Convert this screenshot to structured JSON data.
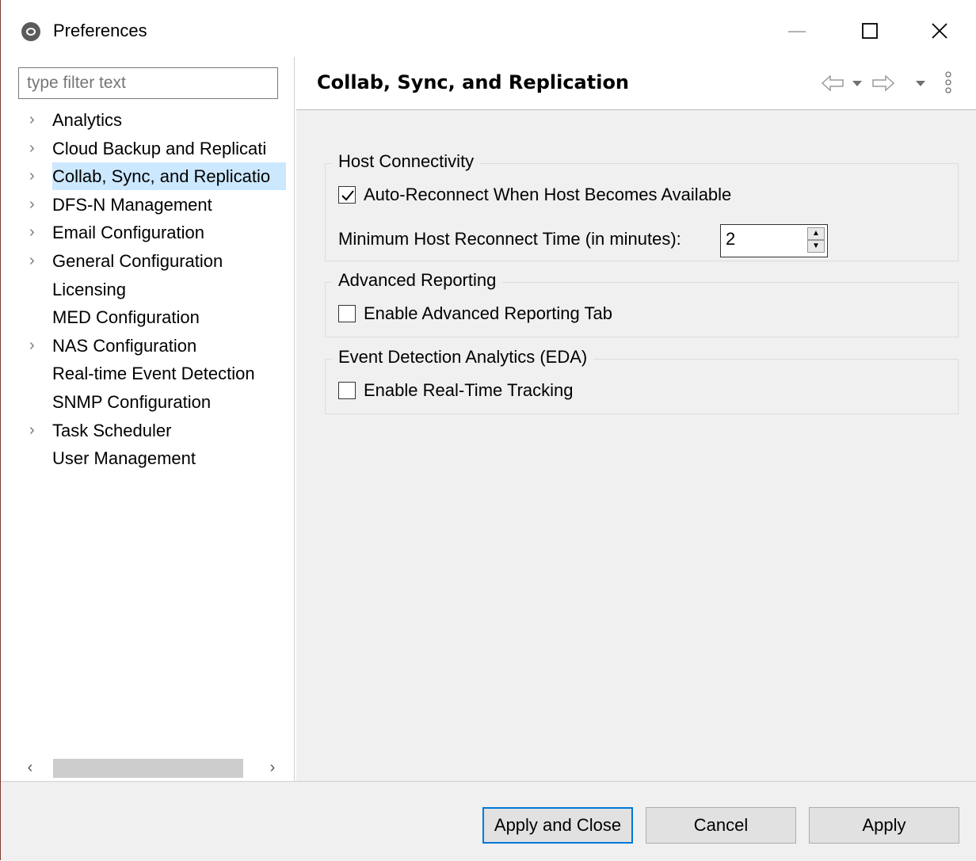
{
  "window": {
    "title": "Preferences",
    "controls": {
      "minimize": "—",
      "maximize": "☐",
      "close": "✕"
    }
  },
  "sidebar": {
    "filter_placeholder": "type filter text",
    "items": [
      {
        "label": "Analytics",
        "expandable": true
      },
      {
        "label": "Cloud Backup and Replicati",
        "expandable": true
      },
      {
        "label": "Collab, Sync, and Replicatio",
        "expandable": true,
        "selected": true
      },
      {
        "label": "DFS-N Management",
        "expandable": true
      },
      {
        "label": "Email Configuration",
        "expandable": true
      },
      {
        "label": "General Configuration",
        "expandable": true
      },
      {
        "label": "Licensing",
        "expandable": false
      },
      {
        "label": "MED Configuration",
        "expandable": false
      },
      {
        "label": "NAS Configuration",
        "expandable": true
      },
      {
        "label": "Real-time Event Detection",
        "expandable": false
      },
      {
        "label": "SNMP Configuration",
        "expandable": false
      },
      {
        "label": "Task Scheduler",
        "expandable": true
      },
      {
        "label": "User Management",
        "expandable": false
      }
    ]
  },
  "page": {
    "title": "Collab, Sync, and Replication",
    "groups": {
      "host": {
        "title": "Host Connectivity",
        "auto_reconnect_label": "Auto-Reconnect When Host Becomes Available",
        "auto_reconnect_checked": true,
        "min_time_label": "Minimum Host Reconnect Time (in minutes):",
        "min_time_value": "2"
      },
      "reporting": {
        "title": "Advanced Reporting",
        "enable_label": "Enable Advanced Reporting Tab",
        "enable_checked": false
      },
      "eda": {
        "title": "Event Detection Analytics (EDA)",
        "enable_label": "Enable Real-Time Tracking",
        "enable_checked": false
      }
    }
  },
  "footer": {
    "apply_close_label": "Apply and Close",
    "cancel_label": "Cancel",
    "apply_label": "Apply"
  },
  "colors": {
    "selection": "#cce8ff",
    "focus": "#0078d7",
    "panel": "#f0f0f0"
  }
}
